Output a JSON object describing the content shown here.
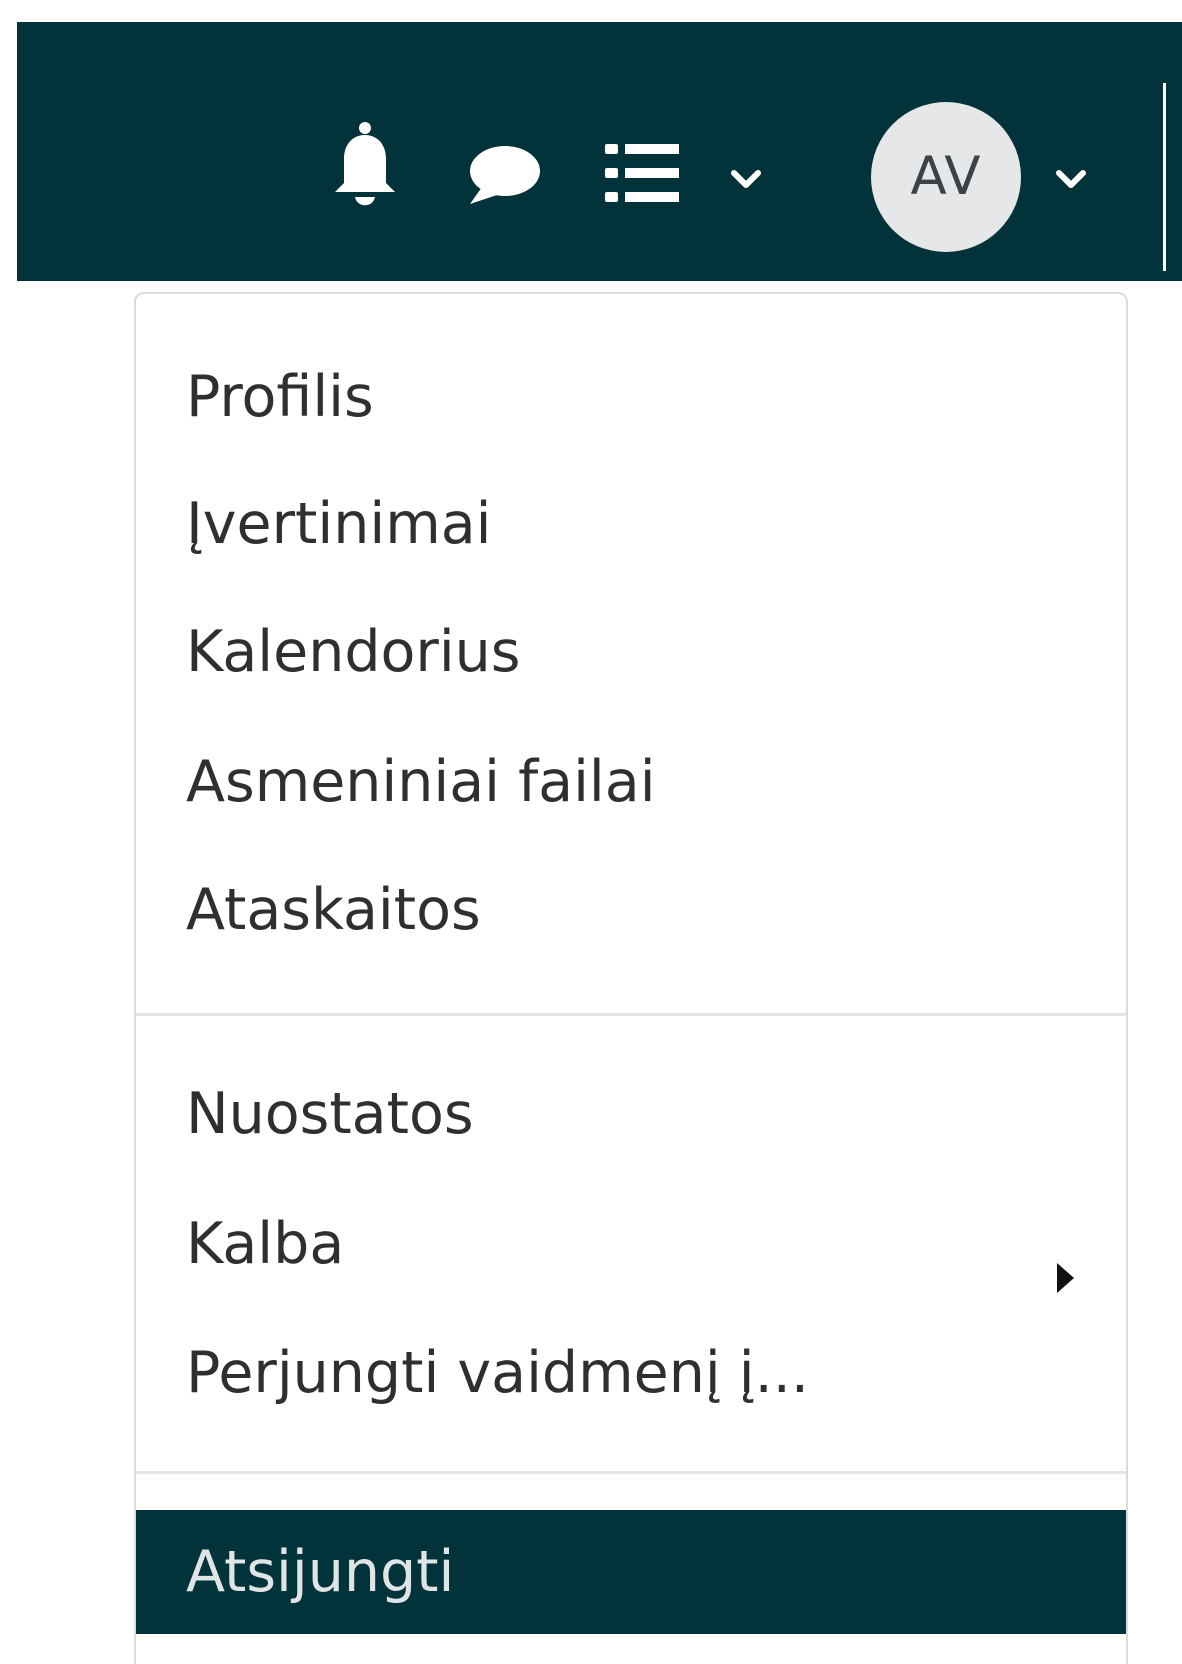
{
  "navbar": {
    "background_color": "#03333a",
    "icons": {
      "notifications": "bell-icon",
      "messages": "message-icon",
      "list": "list-icon",
      "list_dropdown": "chevron-down-icon",
      "user_dropdown": "chevron-down-icon"
    },
    "user": {
      "initials": "AV"
    }
  },
  "user_menu": {
    "items": [
      {
        "label": "Profilis"
      },
      {
        "label": "Įvertinimai"
      },
      {
        "label": "Kalendorius"
      },
      {
        "label": "Asmeniniai failai"
      },
      {
        "label": "Ataskaitos"
      },
      {
        "label": "Nuostatos"
      },
      {
        "label": "Kalba",
        "submenu_icon": "caret-right-icon"
      },
      {
        "label": "Perjungti vaidmenį į..."
      }
    ],
    "logout": {
      "label": "Atsijungti",
      "highlight_color": "#03333a"
    }
  }
}
